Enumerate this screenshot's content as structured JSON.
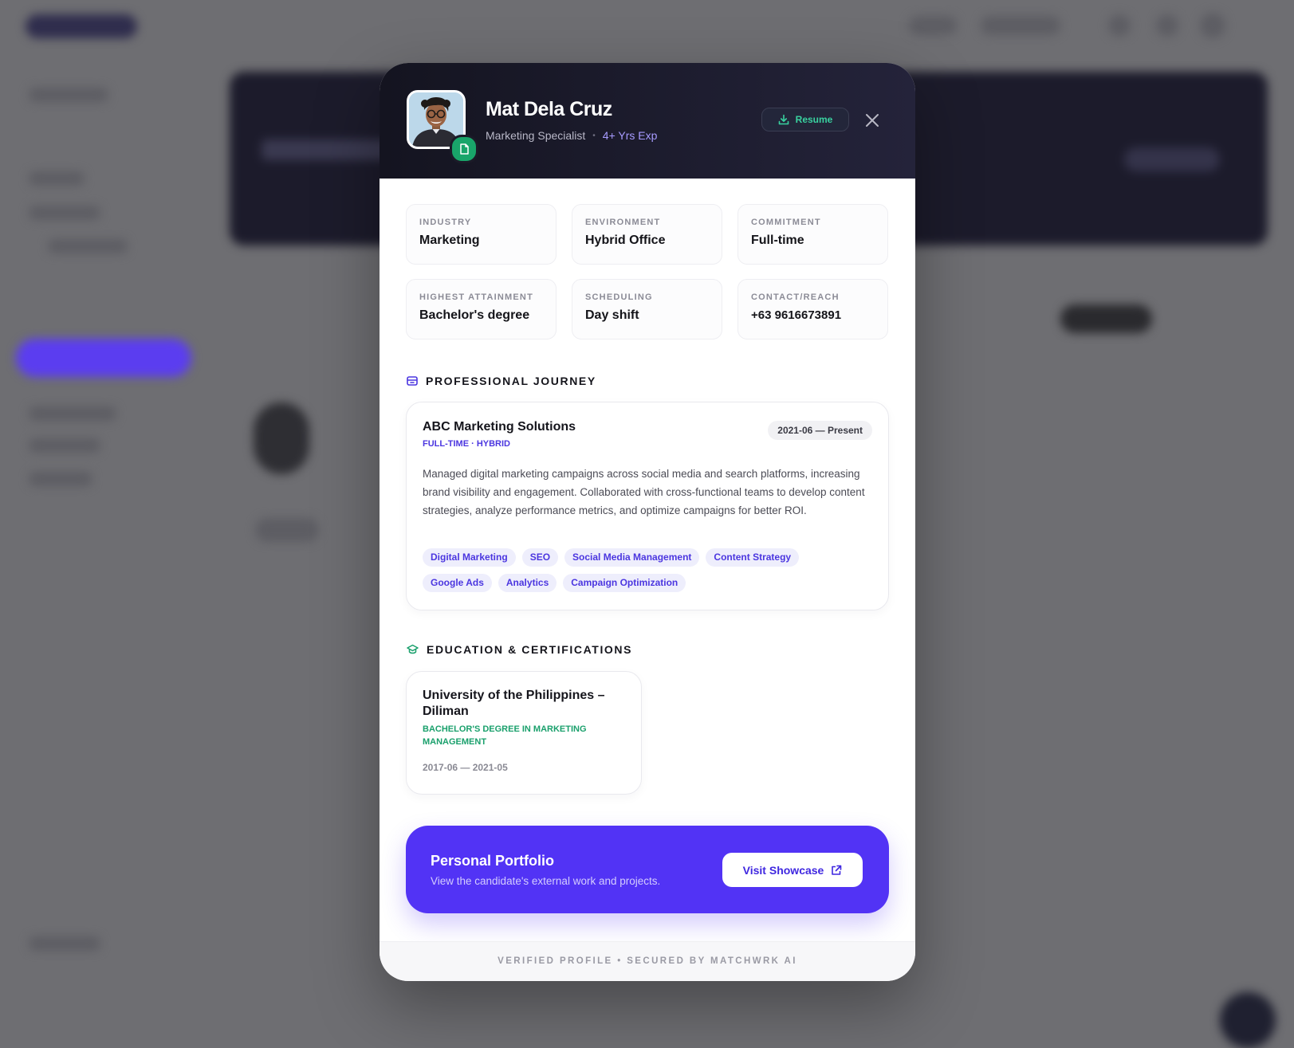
{
  "profile": {
    "name": "Mat Dela Cruz",
    "role": "Marketing Specialist",
    "separator": "•",
    "experience": "4+ Yrs Exp",
    "resume_label": "Resume"
  },
  "info": [
    {
      "label": "INDUSTRY",
      "value": "Marketing"
    },
    {
      "label": "ENVIRONMENT",
      "value": "Hybrid Office"
    },
    {
      "label": "COMMITMENT",
      "value": "Full-time"
    },
    {
      "label": "HIGHEST ATTAINMENT",
      "value": "Bachelor's degree"
    },
    {
      "label": "SCHEDULING",
      "value": "Day shift"
    },
    {
      "label": "CONTACT/REACH",
      "value": "+63 9616673891"
    }
  ],
  "journey": {
    "title": "PROFESSIONAL JOURNEY",
    "company": "ABC Marketing Solutions",
    "type": "FULL-TIME · HYBRID",
    "dates": "2021-06 — Present",
    "description": "Managed digital marketing campaigns across social media and search platforms, increasing brand visibility and engagement. Collaborated with cross-functional teams to develop content strategies, analyze performance metrics, and optimize campaigns for better ROI.",
    "tags": [
      "Digital Marketing",
      "SEO",
      "Social Media Management",
      "Content Strategy",
      "Google Ads",
      "Analytics",
      "Campaign Optimization"
    ]
  },
  "education": {
    "title": "EDUCATION & CERTIFICATIONS",
    "school": "University of the Philippines – Diliman",
    "degree": "BACHELOR'S DEGREE IN MARKETING MANAGEMENT",
    "dates": "2017-06 — 2021-05"
  },
  "portfolio": {
    "title": "Personal Portfolio",
    "subtitle": "View the candidate's external work and projects.",
    "button_label": "Visit Showcase"
  },
  "footer": "VERIFIED PROFILE • SECURED BY MATCHWRK AI",
  "colors": {
    "accent": "#5233f5",
    "accent_text": "#4b36e0",
    "success": "#1aa06c",
    "header_bg": "#1b1b28"
  },
  "icons": {
    "resume": "download-icon",
    "close": "close-icon",
    "journey": "briefcase-icon",
    "education": "graduation-cap-icon",
    "portfolio": "external-link-icon",
    "badge": "document-icon"
  }
}
